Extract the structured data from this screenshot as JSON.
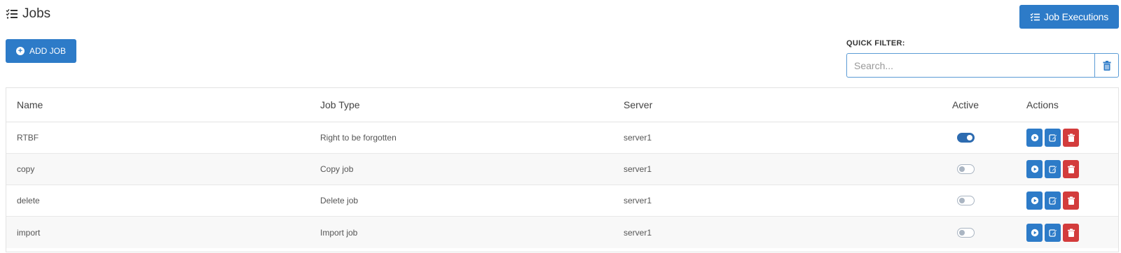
{
  "header": {
    "title": "Jobs",
    "title_icon": "checklist-icon",
    "job_executions_label": "Job Executions",
    "job_executions_icon": "checklist-icon"
  },
  "toolbar": {
    "add_job_label": "ADD JOB",
    "add_job_icon": "plus-circle-icon"
  },
  "filter": {
    "label": "QUICK FILTER:",
    "placeholder": "Search...",
    "value": "",
    "clear_icon": "trash-icon"
  },
  "grid": {
    "columns": {
      "name": "Name",
      "job_type": "Job Type",
      "server": "Server",
      "active": "Active",
      "actions": "Actions"
    },
    "rows": [
      {
        "name": "RTBF",
        "job_type": "Right to be forgotten",
        "server": "server1",
        "active": true
      },
      {
        "name": "copy",
        "job_type": "Copy job",
        "server": "server1",
        "active": false
      },
      {
        "name": "delete",
        "job_type": "Delete job",
        "server": "server1",
        "active": false
      },
      {
        "name": "import",
        "job_type": "Import job",
        "server": "server1",
        "active": false
      }
    ],
    "row_actions": [
      "play-icon",
      "edit-icon",
      "trash-icon"
    ]
  },
  "colors": {
    "primary": "#2d7bc8",
    "danger": "#d33c3c",
    "toggle_on": "#2d6bb0",
    "toggle_off": "#aab5c2"
  }
}
